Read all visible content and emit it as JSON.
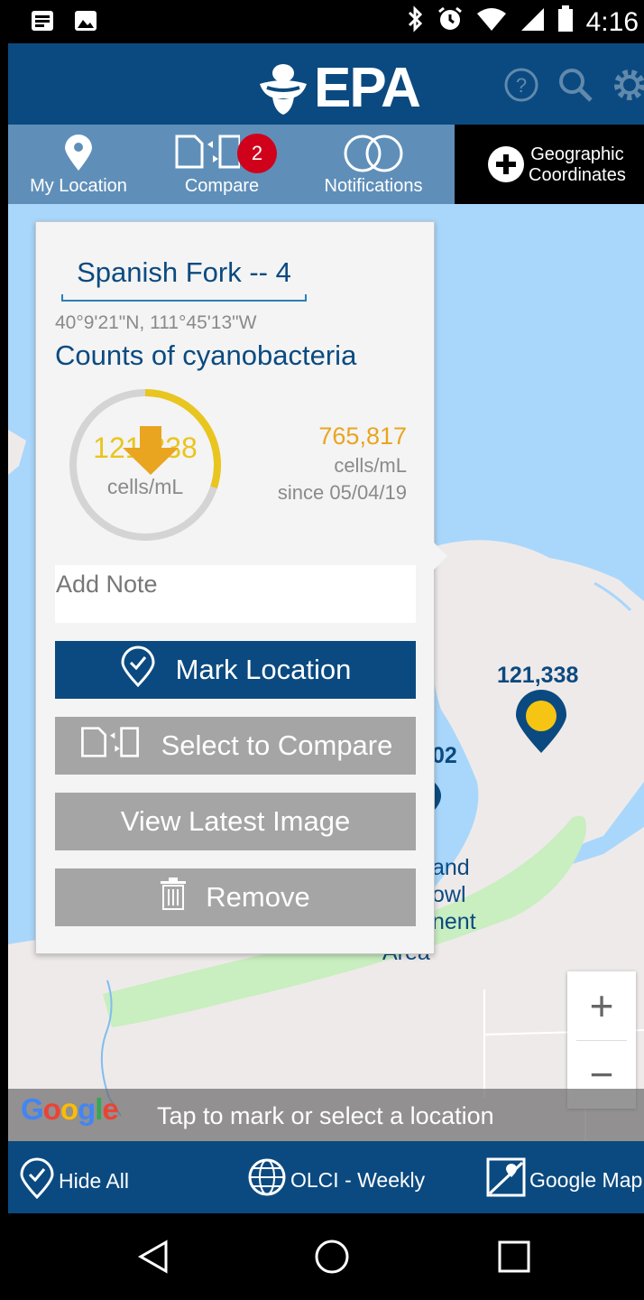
{
  "status": {
    "time": "4:16",
    "icons": [
      "news-icon",
      "image-icon",
      "bluetooth-icon",
      "alarm-icon",
      "wifi-icon",
      "signal-icon",
      "battery-icon"
    ]
  },
  "app": {
    "logo_text": "EPA",
    "icons": [
      "help-icon",
      "search-icon",
      "gear-icon"
    ]
  },
  "tabs": {
    "my_location": "My Location",
    "compare": "Compare",
    "compare_badge": "2",
    "notifications": "Notifications",
    "geo_line1": "Geographic",
    "geo_line2": "Coordinates"
  },
  "popup": {
    "title": "Spanish Fork -- 4",
    "coords": "40°9'21\"N, 111°45'13\"W",
    "heading": "Counts of cyanobacteria",
    "gauge_value": "121,338",
    "gauge_unit": "cells/mL",
    "gauge_fraction": 0.3,
    "change_value": "765,817",
    "change_unit": "cells/mL",
    "change_since": "since 05/04/19",
    "note_placeholder": "Add Note",
    "mark_location": "Mark Location",
    "select_compare": "Select to Compare",
    "view_image": "View Latest Image",
    "remove": "Remove"
  },
  "map": {
    "marker_label": "121,338",
    "partial_label": "02",
    "area_line1": "and",
    "area_line2": "owl",
    "area_line3": "nent",
    "area_line4": "Area",
    "zoom_in": "+",
    "zoom_out": "−"
  },
  "hint": {
    "google": "Google",
    "text": "Tap to mark or select a location"
  },
  "bottom": {
    "hide_all": "Hide All",
    "layer": "OLCI - Weekly",
    "basemap": "Google Map"
  },
  "colors": {
    "primary": "#0b4a80",
    "tab": "#5f8fb9",
    "gauge": "#e9c51f",
    "water": "#a9d7fb",
    "land": "#efeaea",
    "park": "#c9eec0"
  }
}
